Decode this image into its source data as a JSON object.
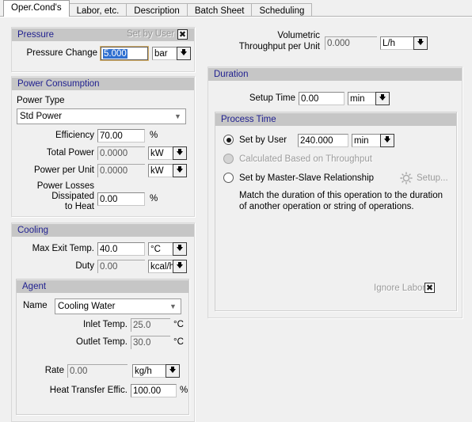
{
  "tabs": [
    {
      "label": "Oper.Cond's",
      "active": true
    },
    {
      "label": "Labor, etc.",
      "active": false
    },
    {
      "label": "Description",
      "active": false
    },
    {
      "label": "Batch Sheet",
      "active": false
    },
    {
      "label": "Scheduling",
      "active": false
    }
  ],
  "pressure": {
    "title": "Pressure",
    "set_by_user_label": "Set by User",
    "set_by_user_checked": "✖",
    "change_label": "Pressure Change",
    "change_value": "5.000",
    "change_unit": "bar"
  },
  "power": {
    "title": "Power Consumption",
    "type_label": "Power Type",
    "type_value": "Std Power",
    "efficiency_label": "Efficiency",
    "efficiency_value": "70.00",
    "efficiency_unit": "%",
    "total_label": "Total Power",
    "total_value": "0.0000",
    "total_unit": "kW",
    "per_unit_label": "Power per Unit",
    "per_unit_value": "0.0000",
    "per_unit_unit": "kW",
    "losses_label_1": "Power Losses",
    "losses_label_2": "Dissipated",
    "losses_label_3": "to Heat",
    "losses_value": "0.00",
    "losses_unit": "%"
  },
  "cooling": {
    "title": "Cooling",
    "max_exit_label": "Max Exit Temp.",
    "max_exit_value": "40.0",
    "max_exit_unit": "°C",
    "duty_label": "Duty",
    "duty_value": "0.00",
    "duty_unit": "kcal/h",
    "agent": {
      "title": "Agent",
      "name_label": "Name",
      "name_value": "Cooling Water",
      "inlet_label": "Inlet Temp.",
      "inlet_value": "25.0",
      "inlet_unit": "°C",
      "outlet_label": "Outlet Temp.",
      "outlet_value": "30.0",
      "outlet_unit": "°C",
      "rate_label": "Rate",
      "rate_value": "0.00",
      "rate_unit": "kg/h",
      "hte_label": "Heat Transfer Effic.",
      "hte_value": "100.00",
      "hte_unit": "%"
    }
  },
  "throughput": {
    "label_line1": "Volumetric",
    "label_line2": "Throughput per Unit",
    "value": "0.000",
    "unit": "L/h"
  },
  "duration": {
    "title": "Duration",
    "setup_time_label": "Setup Time",
    "setup_time_value": "0.00",
    "setup_time_unit": "min",
    "process": {
      "title": "Process Time",
      "opt_user_label": "Set by User",
      "opt_user_value": "240.000",
      "opt_user_unit": "min",
      "opt_calc_label": "Calculated Based on Throughput",
      "opt_master_label": "Set by Master-Slave Relationship",
      "setup_button_label": "Setup...",
      "note": "Match the duration of this operation to the duration of another operation or string of operations.",
      "ignore_labor_label": "Ignore Labor",
      "ignore_labor_checked": "✖"
    }
  },
  "colors": {
    "panel_header_bg": "#c6c6c6",
    "panel_header_text": "#1f1f8f",
    "window_bg": "#f0f0f0",
    "selection_blue": "#2f6fd0"
  }
}
